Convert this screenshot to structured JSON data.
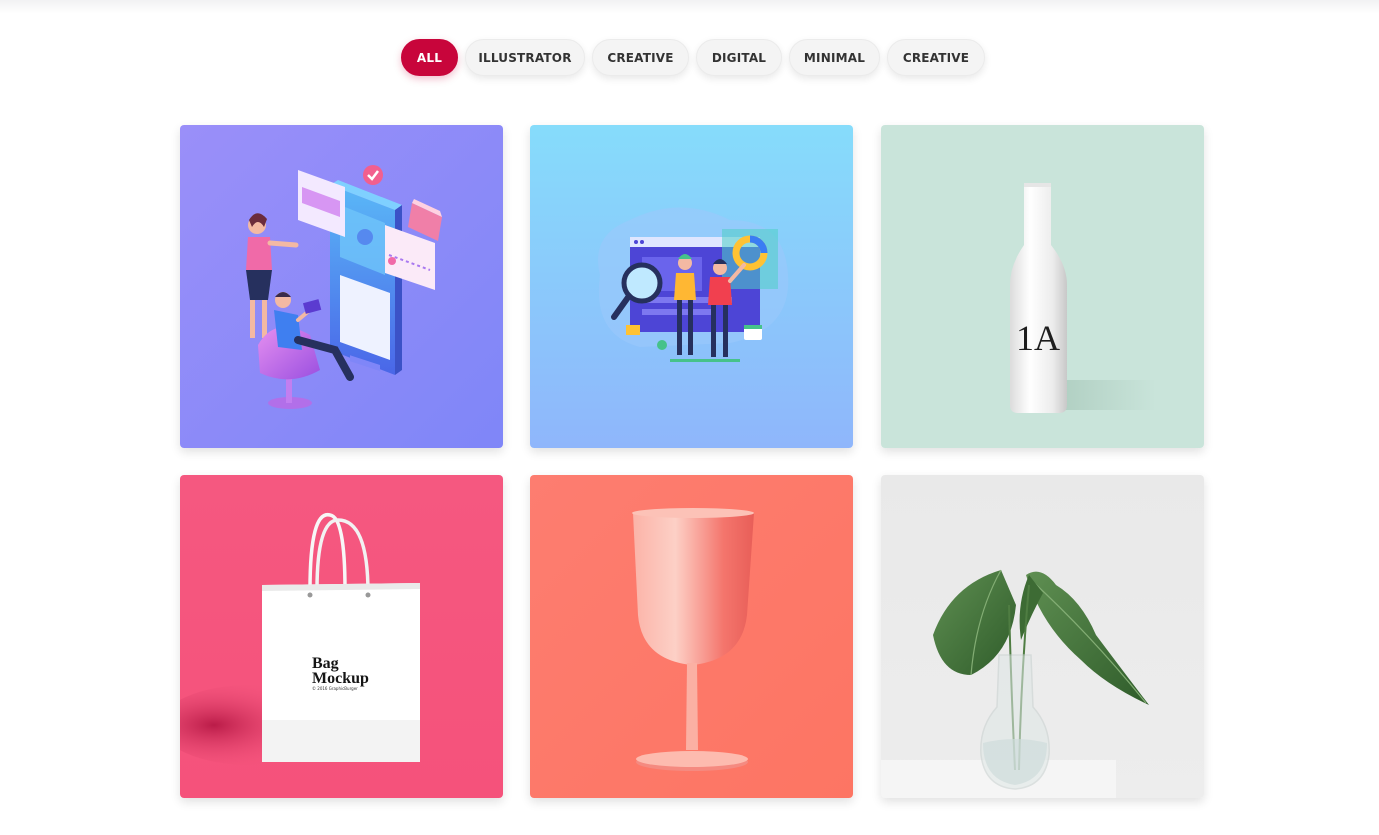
{
  "filters": [
    {
      "label": "ALL",
      "active": true
    },
    {
      "label": "ILLUSTRATOR",
      "active": false
    },
    {
      "label": "CREATIVE",
      "active": false
    },
    {
      "label": "DIGITAL",
      "active": false
    },
    {
      "label": "MINIMAL",
      "active": false
    },
    {
      "label": "CREATIVE",
      "active": false
    }
  ],
  "colors": {
    "accent": "#c8053b",
    "pill_bg": "#f4f4f4",
    "card1_bg": "#8c88f6",
    "card2_bg": "#8cc8fb",
    "card3_bg": "#c9e4da",
    "card4_bg": "#f5587f",
    "card5_bg": "#fd7a6c",
    "card6_bg": "#e9e9e9"
  },
  "portfolio": {
    "items": [
      {
        "subject": "isometric-app-illustration"
      },
      {
        "subject": "data-analysis-illustration"
      },
      {
        "subject": "bottle-mockup",
        "label": "1A"
      },
      {
        "subject": "bag-mockup",
        "title_line1": "Bag",
        "title_line2": "Mockup",
        "caption": "© 2016 GraphicBurger"
      },
      {
        "subject": "pink-glass"
      },
      {
        "subject": "plant-in-vase"
      }
    ]
  }
}
